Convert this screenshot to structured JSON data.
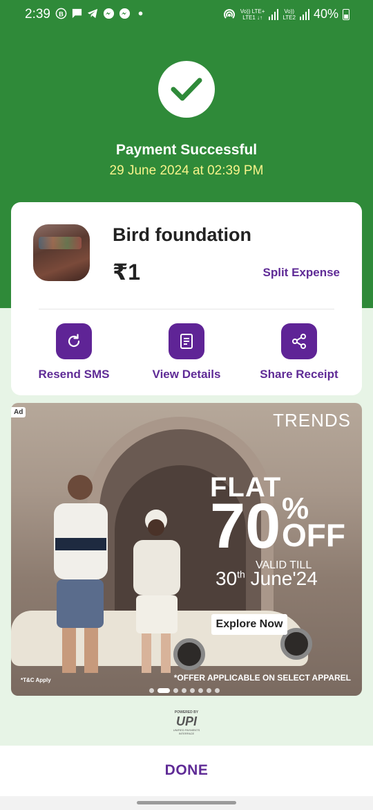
{
  "status_bar": {
    "time": "2:39",
    "network1": "Vo)) LTE+\nLTE1 ↓↑",
    "network2": "Vo))\nLTE2",
    "battery": "40%"
  },
  "header": {
    "title": "Payment Successful",
    "datetime": "29 June 2024 at 02:39 PM"
  },
  "payment": {
    "payee": "Bird foundation",
    "amount": "₹1",
    "split_label": "Split Expense"
  },
  "actions": [
    {
      "label": "Resend SMS",
      "icon": "refresh-icon"
    },
    {
      "label": "View Details",
      "icon": "document-icon"
    },
    {
      "label": "Share Receipt",
      "icon": "share-icon"
    }
  ],
  "ad": {
    "tag": "Ad",
    "brand": "TRENDS",
    "flat": "FLAT",
    "discount": "70",
    "percent": "%",
    "off": "OFF",
    "valid": "VALID TILL",
    "date_day": "30",
    "date_sup": "th",
    "date_rest": " June'24",
    "cta": "Explore Now",
    "fine_print": "*OFFER APPLICABLE ON SELECT APPAREL",
    "tc": "*T&C Apply",
    "slide_count": 8,
    "active_slide": 2
  },
  "upi": {
    "powered": "POWERED BY",
    "logo": "UPI",
    "sub": "UNIFIED PAYMENTS INTERFACE"
  },
  "footer": {
    "done_label": "DONE"
  },
  "colors": {
    "header_green": "#2f8a39",
    "accent_purple": "#5f2496",
    "date_yellow": "#f7f38a",
    "page_bg": "#e7f4e6"
  }
}
